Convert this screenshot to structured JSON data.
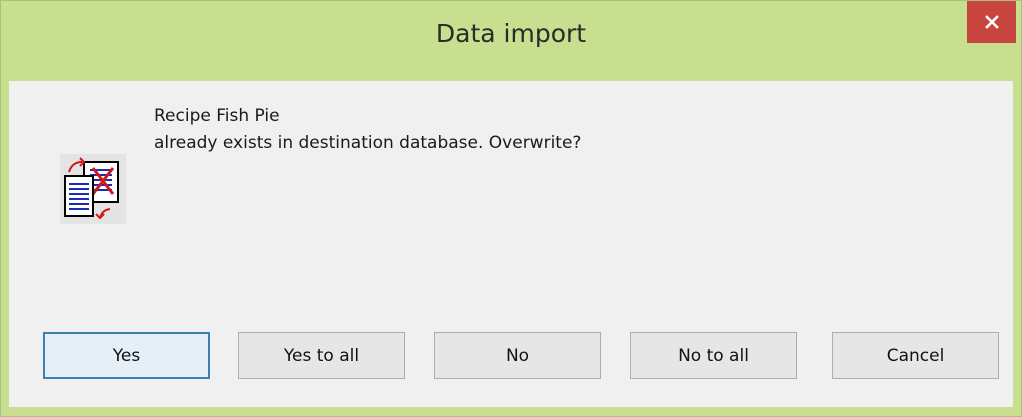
{
  "window": {
    "title": "Data import"
  },
  "message": {
    "line1": "Recipe Fish Pie",
    "line2": "already exists in destination database. Overwrite?"
  },
  "buttons": {
    "yes": "Yes",
    "yes_to_all": "Yes to all",
    "no": "No",
    "no_to_all": "No to all",
    "cancel": "Cancel"
  },
  "icons": {
    "close": "close-icon",
    "dialog": "database-import-icon"
  },
  "colors": {
    "titlebar": "#c7df8f",
    "close_button": "#c7453e",
    "client_area": "#f0f0f0",
    "default_button_border": "#3c7fb1"
  }
}
